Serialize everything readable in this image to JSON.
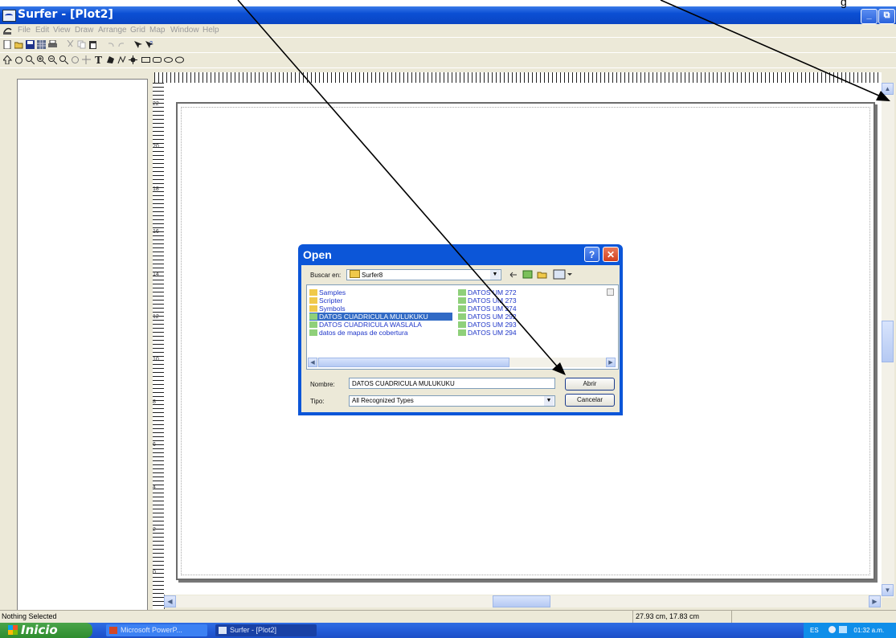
{
  "window": {
    "title": "Surfer - [Plot2]",
    "controls": {
      "minimize": "_",
      "maximize": "⧉"
    }
  },
  "menu": [
    "File",
    "Edit",
    "View",
    "Draw",
    "Arrange",
    "Grid",
    "Map",
    "Window",
    "Help"
  ],
  "toolbar1_icons": [
    "new-icon",
    "open-icon",
    "save-icon",
    "grid-icon",
    "print-icon",
    "cut-icon",
    "copy-icon",
    "paste-icon",
    "undo-icon",
    "redo-icon",
    "select-icon",
    "help-pointer-icon"
  ],
  "toolbar2_icons": [
    "pointer-icon",
    "hand-icon",
    "zoom-rect-icon",
    "zoom-in-icon",
    "zoom-out-icon",
    "zoom-page-icon",
    "rotate-icon",
    "reshape-icon",
    "text-icon",
    "polygon-icon",
    "polyline-icon",
    "symbol-icon",
    "rectangle-icon",
    "rounded-rect-icon",
    "ellipse-icon"
  ],
  "ruler_labels": [
    "22",
    "20",
    "18",
    "16",
    "14",
    "12",
    "10",
    "8",
    "6",
    "4",
    "2",
    "0"
  ],
  "dialog": {
    "title": "Open",
    "help": "?",
    "close": "✕",
    "lookin_label": "Buscar en:",
    "lookin_value": "Surfer8",
    "files_left": [
      {
        "name": "Samples",
        "kind": "folder"
      },
      {
        "name": "Scripter",
        "kind": "folder"
      },
      {
        "name": "Symbols",
        "kind": "folder"
      },
      {
        "name": "DATOS CUADRICULA MULUKUKU",
        "kind": "file",
        "selected": true
      },
      {
        "name": "DATOS CUADRICULA WASLALA",
        "kind": "file"
      },
      {
        "name": "datos de mapas de cobertura",
        "kind": "file"
      }
    ],
    "files_right": [
      {
        "name": "DATOS UM 272"
      },
      {
        "name": "DATOS UM 273"
      },
      {
        "name": "DATOS UM 274"
      },
      {
        "name": "DATOS UM 292"
      },
      {
        "name": "DATOS UM 293"
      },
      {
        "name": "DATOS UM 294"
      }
    ],
    "filename_label": "Nombre:",
    "filename_value": "DATOS CUADRICULA MULUKUKU",
    "filetype_label": "Tipo:",
    "filetype_value": "All Recognized Types",
    "open_button": "Abrir",
    "cancel_button": "Cancelar"
  },
  "status": {
    "left": "Nothing Selected",
    "coords": "27.93 cm, 17.83 cm"
  },
  "taskbar": {
    "start": "Inicio",
    "tasks": [
      "Microsoft PowerP...",
      "Surfer - [Plot2]"
    ],
    "lang": "ES",
    "clock": "01:32 a.m."
  },
  "annotation_fragment": "g",
  "colors": {
    "titlebar": "#0b4fd4",
    "taskbar": "#245dd8",
    "start": "#3a9a3a",
    "selection": "#316ac5",
    "dialog_face": "#ece9d8",
    "close_button": "#e0482a"
  }
}
